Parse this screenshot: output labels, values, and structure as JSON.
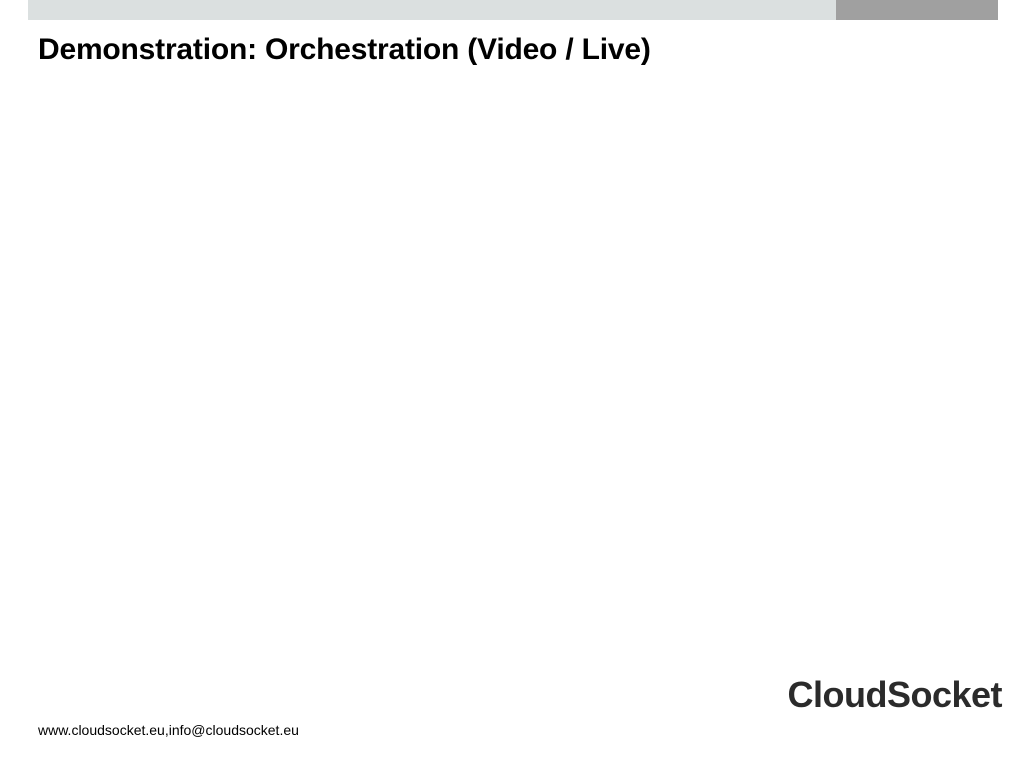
{
  "header": {
    "colors": {
      "bar_left": "#dbe0e0",
      "bar_right": "#a0a0a0"
    }
  },
  "slide": {
    "title": "Demonstration: Orchestration (Video / Live)"
  },
  "footer": {
    "contact": "www.cloudsocket.eu,info@cloudsocket.eu",
    "brand": "CloudSocket"
  }
}
